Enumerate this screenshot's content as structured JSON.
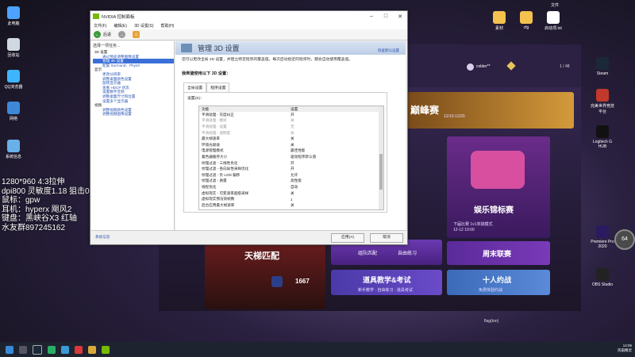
{
  "desktop_left": [
    {
      "label": "此电脑",
      "color": "#4da3ff"
    },
    {
      "label": "回收站",
      "color": "#cfd8e0"
    },
    {
      "label": "QQ浏览器",
      "color": "#3fb5ff"
    },
    {
      "label": "网络",
      "color": "#3f88d8"
    },
    {
      "label": "系统信息",
      "color": "#6ab0e8"
    }
  ],
  "overlay_text": [
    "1280*960 4:3拉伸",
    "dpi800 灵敏度1.18 狙击0.9",
    "鼠标：gpw",
    "耳机：hyperx 飓风2",
    "键盘：黑峡谷X3 红轴",
    "水友群897245162"
  ],
  "desktop_top_right": {
    "folder_label": "文件",
    "icons": [
      {
        "label": "素材",
        "color": "#f2c14e"
      },
      {
        "label": "cfg",
        "color": "#f2c14e"
      },
      {
        "label": "启动项.txt",
        "color": "#ffffff"
      }
    ]
  },
  "desktop_right": [
    {
      "label": "Steam",
      "color": "#1b2838"
    },
    {
      "label": "完美世界竞技平台",
      "color": "#c0392b"
    },
    {
      "label": "Logitech G HUB",
      "color": "#111111"
    },
    {
      "label": "Premiere Pro 2020",
      "color": "#2a1a5e"
    },
    {
      "label": "OBS Studio",
      "color": "#222222"
    }
  ],
  "badge_64": "64",
  "launcher": {
    "user": "colder**",
    "page_counter": "1 / 48",
    "tiles": {
      "tournament_title": "巅峰赛",
      "tournament_date": "12/10-12/20",
      "entertainment_title": "娱乐锦标赛",
      "entertainment_sub1": "下届比赛 1v1单挑模式",
      "entertainment_sub2": "12-12 19:00",
      "ladder_title": "天梯匹配",
      "ladder_score": "1667",
      "team_practice_1": "组队匹配",
      "team_practice_2": "自由练习",
      "weekly": "周末联赛",
      "tutorial_title": "道具教学&考试",
      "tutorial_sub": "新手教学 · 自由练习 · 道具考试",
      "duel_title": "十人约战",
      "duel_sub": "免费体验约战"
    },
    "bottom_label": "flag(ton)"
  },
  "nvidia": {
    "title": "NVIDIA 控制面板",
    "menu": [
      "文件(F)",
      "编辑(E)",
      "3D 设置(S)",
      "帮助(H)"
    ],
    "toolbar": {
      "back": "后退",
      "back_arrow": "←",
      "fwd_arrow": "→",
      "home_glyph": "⌂"
    },
    "left_header": "选择一项任务...",
    "tree": [
      {
        "level": 1,
        "text": "3D 设置"
      },
      {
        "level": 2,
        "text": "通过预览调整图像设置"
      },
      {
        "level": 2,
        "text": "管理 3D 设置",
        "selected": true
      },
      {
        "level": 2,
        "text": "配置 Surround、PhysX"
      },
      {
        "level": 1,
        "text": "显示"
      },
      {
        "level": 2,
        "text": "更改分辨率"
      },
      {
        "level": 2,
        "text": "调整桌面颜色设置"
      },
      {
        "level": 2,
        "text": "旋转显示器"
      },
      {
        "level": 2,
        "text": "查看 HDCP 状态"
      },
      {
        "level": 2,
        "text": "设置数字音频"
      },
      {
        "level": 2,
        "text": "调整桌面尺寸和位置"
      },
      {
        "level": 2,
        "text": "设置多个显示器"
      },
      {
        "level": 1,
        "text": "视频"
      },
      {
        "level": 2,
        "text": "调整视频颜色设置"
      },
      {
        "level": 2,
        "text": "调整视频图像设置"
      }
    ],
    "system_info": "系统信息",
    "panel_title": "管理 3D 设置",
    "restore_link": "恢复默认设置",
    "description": "您可以更改全局 3D 设置，并建立特定程序的覆盖值。每次启动指定的程序时，都会自动使用覆盖值。",
    "section": "我希望使用以下 3D 设置：",
    "tabs": [
      "全局设置",
      "程序设置"
    ],
    "settings_label": "设置(S)：",
    "columns": [
      "功能",
      "设置"
    ],
    "rows": [
      {
        "feature": "平滑处理 - 灰度纠正",
        "value": "开",
        "dim": false
      },
      {
        "feature": "平滑处理 - 模式",
        "value": "关",
        "dim": true
      },
      {
        "feature": "平滑处理 - 设置",
        "value": "无",
        "dim": true
      },
      {
        "feature": "平滑处理 - 透明度",
        "value": "关",
        "dim": true
      },
      {
        "feature": "最大帧速率",
        "value": "关",
        "dim": false
      },
      {
        "feature": "环境光吸收",
        "value": "关",
        "dim": false
      },
      {
        "feature": "电源管理模式",
        "value": "最佳性能",
        "dim": false
      },
      {
        "feature": "着色器缓存大小",
        "value": "驱动程序默认值",
        "dim": false
      },
      {
        "feature": "纹理过滤 - 三线性优化",
        "value": "开",
        "dim": false
      },
      {
        "feature": "纹理过滤 - 各向异性采样优化",
        "value": "开",
        "dim": false
      },
      {
        "feature": "纹理过滤 - 负 LOD 偏移",
        "value": "允许",
        "dim": false
      },
      {
        "feature": "纹理过滤 - 质量",
        "value": "高性能",
        "dim": false
      },
      {
        "feature": "线程优化",
        "value": "自动",
        "dim": false
      },
      {
        "feature": "虚拟现实 - 可变速率超级采样",
        "value": "关",
        "dim": false
      },
      {
        "feature": "虚拟现实预渲染帧数",
        "value": "1",
        "dim": false
      },
      {
        "feature": "后台应用最大帧速率",
        "value": "关",
        "dim": false
      }
    ],
    "apply": "应用(A)",
    "cancel": "取消"
  },
  "clock": {
    "time": "14:06",
    "date": "2021/12/10"
  },
  "tray_text": "风扇精灵"
}
